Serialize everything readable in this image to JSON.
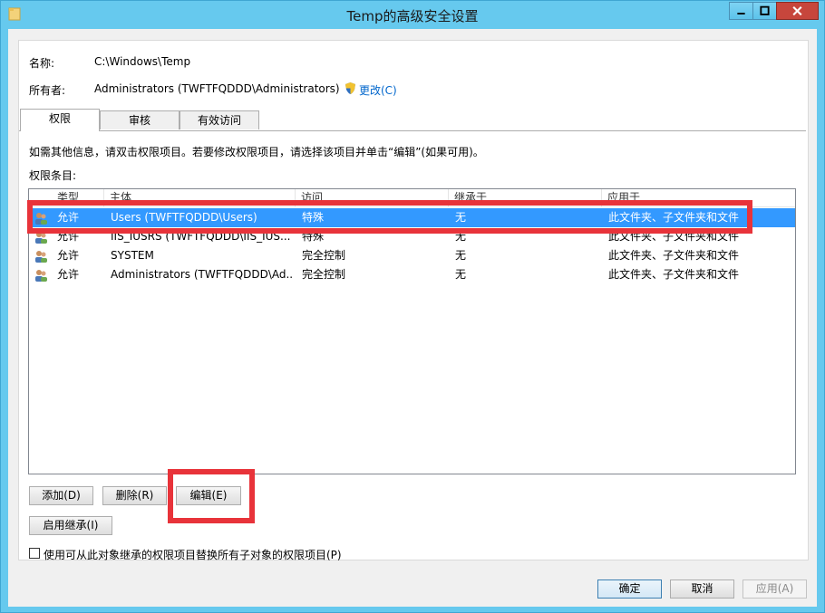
{
  "window": {
    "title": "Temp的高级安全设置",
    "icon": "folder-icon",
    "controls": [
      "minimize-icon",
      "maximize-icon",
      "close-icon"
    ]
  },
  "name_label": "名称:",
  "name_value": "C:\\Windows\\Temp",
  "owner_label": "所有者:",
  "owner_value": "Administrators (TWFTFQDDD\\Administrators)",
  "owner_change": "更改(C)",
  "tabs": [
    "权限",
    "审核",
    "有效访问"
  ],
  "info_text": "如需其他信息，请双击权限项目。若要修改权限项目，请选择该项目并单击“编辑”(如果可用)。",
  "entries_label": "权限条目:",
  "columns": [
    "类型",
    "主体",
    "访问",
    "继承于",
    "应用于"
  ],
  "rows": [
    {
      "type": "允许",
      "principal": "Users (TWFTFQDDD\\Users)",
      "access": "特殊",
      "inherited": "无",
      "applies": "此文件夹、子文件夹和文件"
    },
    {
      "type": "允许",
      "principal": "IIS_IUSRS (TWFTFQDDD\\IIS_IUS...",
      "access": "特殊",
      "inherited": "无",
      "applies": "此文件夹、子文件夹和文件"
    },
    {
      "type": "允许",
      "principal": "SYSTEM",
      "access": "完全控制",
      "inherited": "无",
      "applies": "此文件夹、子文件夹和文件"
    },
    {
      "type": "允许",
      "principal": "Administrators (TWFTFQDDD\\Ad...",
      "access": "完全控制",
      "inherited": "无",
      "applies": "此文件夹、子文件夹和文件"
    }
  ],
  "buttons": {
    "add": "添加(D)",
    "remove": "删除(R)",
    "edit": "编辑(E)",
    "enable_inheritance": "启用继承(I)",
    "ok": "确定",
    "cancel": "取消",
    "apply": "应用(A)"
  },
  "replace_checkbox_label": "使用可从此对象继承的权限项目替换所有子对象的权限项目(P)",
  "colors": {
    "titlebar": "#66c9ee",
    "selection": "#3399ff",
    "highlight": "#e8333a",
    "close": "#c7463c"
  }
}
